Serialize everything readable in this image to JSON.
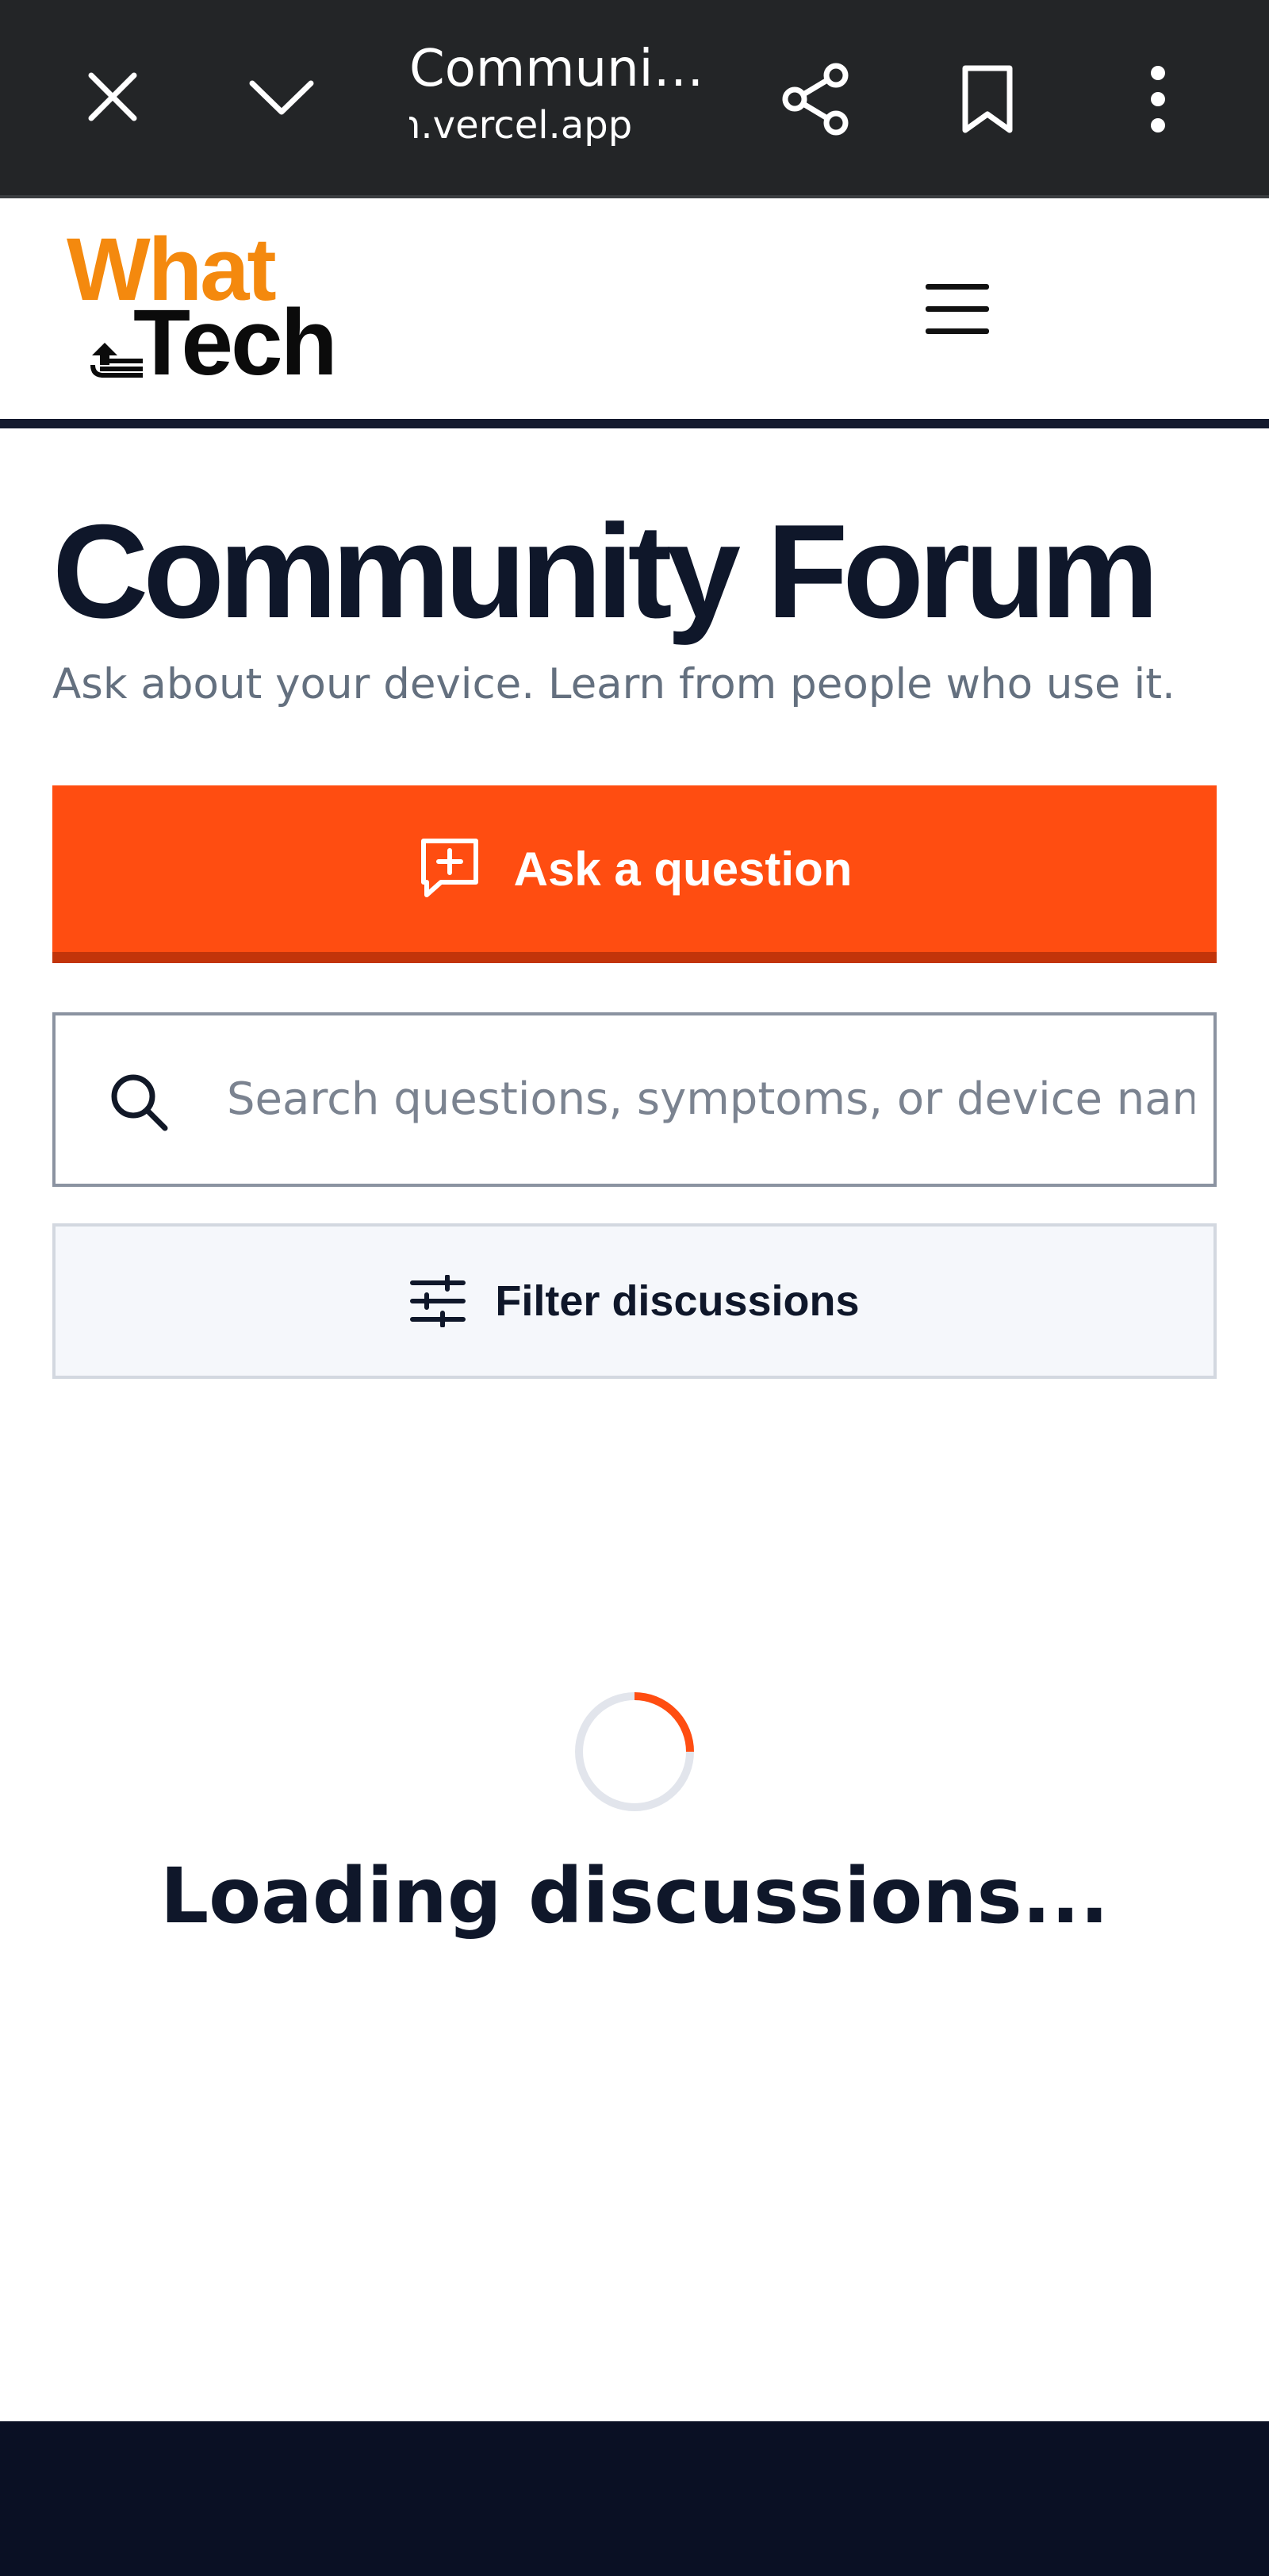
{
  "browser": {
    "page_title": "Communi…",
    "url": "n.vercel.app",
    "icons": [
      "close-icon",
      "chevron-down-icon",
      "share-icon",
      "bookmark-icon",
      "more-vert-icon"
    ]
  },
  "header": {
    "logo_line1": "What",
    "logo_line2": "Tech",
    "menu_icon": "menu-icon"
  },
  "main": {
    "headline": "Community Forum",
    "subtitle": "Ask about your device. Learn from people who use it.",
    "ask_button_label": "Ask a question",
    "search_placeholder": "Search questions, symptoms, or device names",
    "search_value": "",
    "filter_button_label": "Filter discussions",
    "loading_text": "Loading discussions..."
  },
  "colors": {
    "accent": "#ff4d11",
    "accent_dark": "#c2340a",
    "logo_orange": "#f4890e",
    "text_dark": "#0f172a",
    "footer": "#0a1024",
    "chrome": "#232527"
  }
}
